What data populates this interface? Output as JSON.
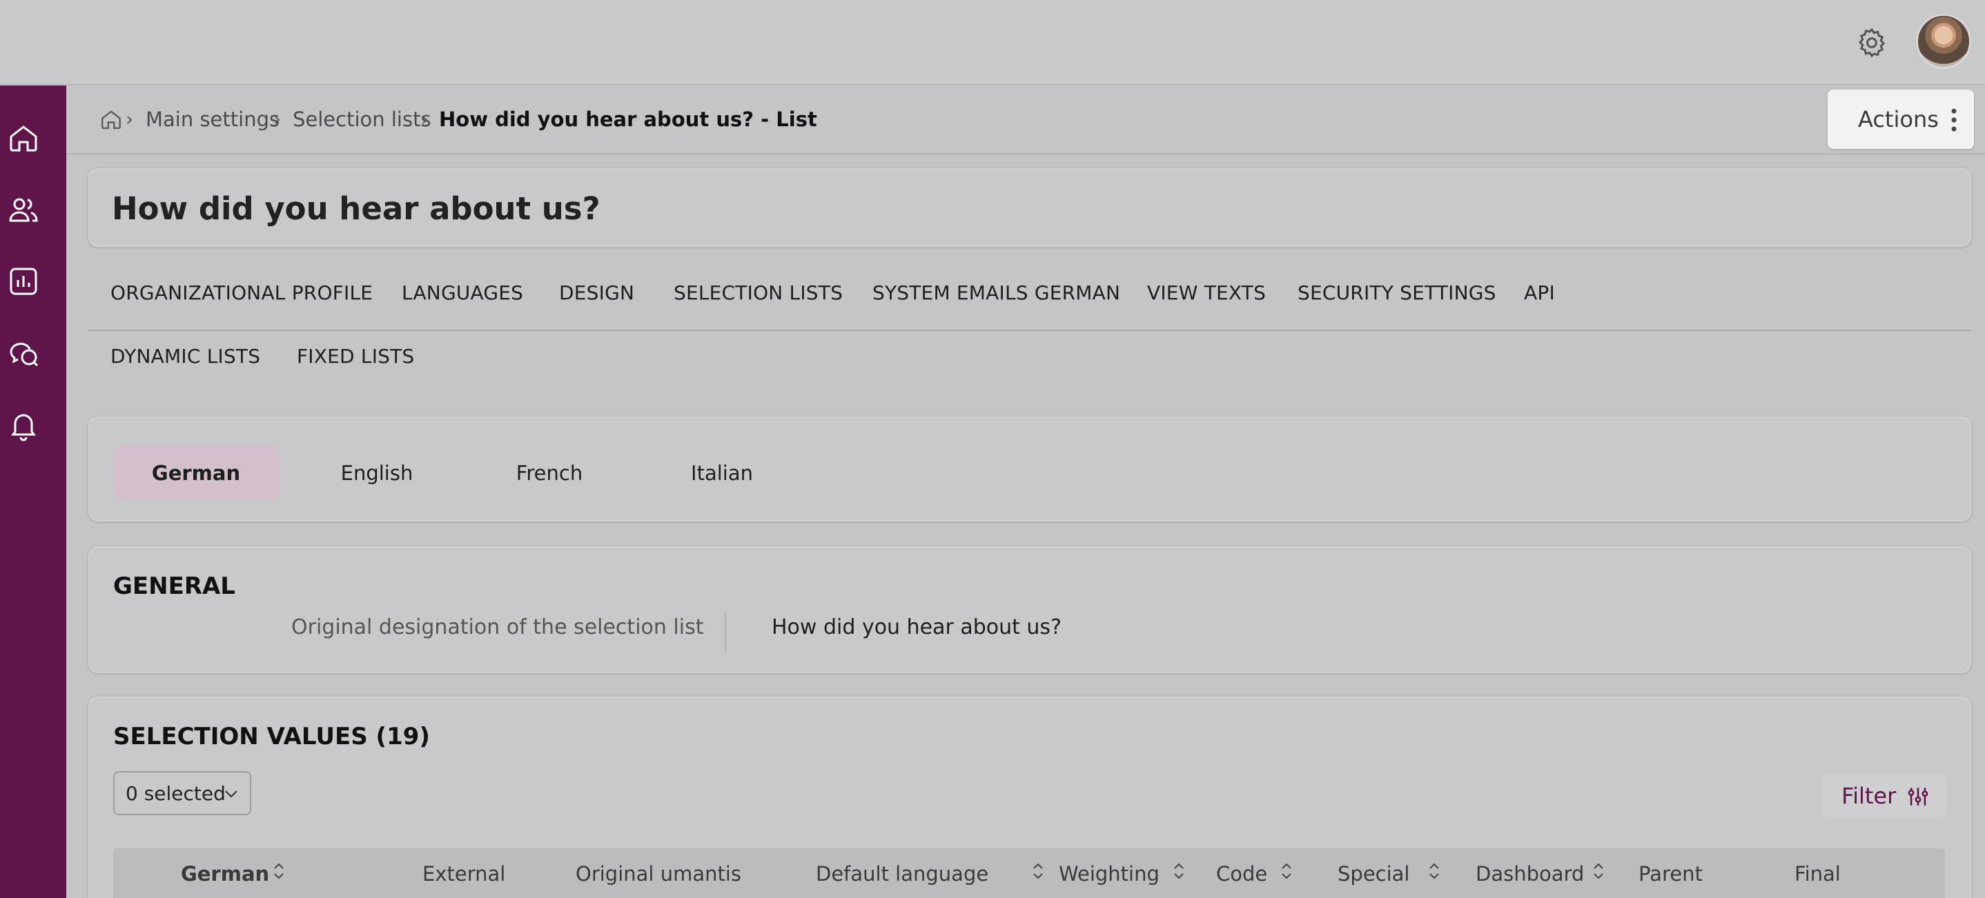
{
  "topbar": {
    "icons": [
      "gear-icon",
      "user-avatar"
    ]
  },
  "sidebar": {
    "icons": [
      "home-icon",
      "users-icon",
      "reports-icon",
      "chat-icon",
      "bell-icon"
    ]
  },
  "breadcrumb": {
    "home_icon": "home-icon",
    "items": [
      "Main settings",
      "Selection lists",
      "How did you hear about us? - List"
    ]
  },
  "actions": {
    "label": "Actions",
    "icon": "more-vertical-icon"
  },
  "page": {
    "title": "How did you hear about us?"
  },
  "tabs": {
    "primary": [
      "ORGANIZATIONAL PROFILE",
      "LANGUAGES",
      "DESIGN",
      "SELECTION LISTS",
      "SYSTEM EMAILS GERMAN",
      "VIEW TEXTS",
      "SECURITY SETTINGS",
      "API"
    ],
    "secondary": [
      "DYNAMIC LISTS",
      "FIXED LISTS"
    ]
  },
  "languages": {
    "items": [
      "German",
      "English",
      "French",
      "Italian"
    ],
    "active": "German"
  },
  "general": {
    "title": "GENERAL",
    "field_label": "Original designation of the selection list",
    "field_value": "How did you hear about us?"
  },
  "selection_values": {
    "title": "SELECTION VALUES (19)",
    "selected_label": "0 selected",
    "filter_label": "Filter",
    "columns": [
      "German",
      "External",
      "Original umantis",
      "Default language",
      "Weighting",
      "Code",
      "Special",
      "Dashboard",
      "Parent",
      "Final"
    ]
  },
  "colors": {
    "sidebar": "#5f1549",
    "accent": "#5f1549",
    "active_language_bg": "#d4bfcc",
    "background": "#c5c5c7"
  }
}
